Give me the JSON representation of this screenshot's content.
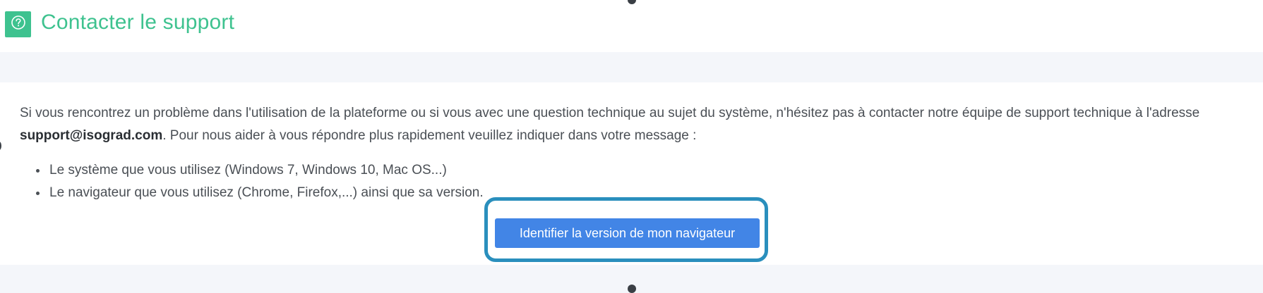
{
  "header": {
    "title": "Contacter le support",
    "icon": "question-circle-icon",
    "accent_color": "#3ec28f"
  },
  "support": {
    "intro_before_email": "Si vous rencontrez un problème dans l'utilisation de la plateforme ou si vous avec une question technique au sujet du système, n'hésitez pas à contacter notre équipe de support technique à l'adresse ",
    "email": "support@isograd.com",
    "intro_after_email": ". Pour nous aider à vous répondre plus rapidement veuillez indiquer dans votre message :",
    "items": [
      "Le système que vous utilisez (Windows 7, Windows 10, Mac OS...)",
      "Le navigateur que vous utilisez (Chrome, Firefox,...) ainsi que sa version."
    ],
    "button_label": "Identifier la version de mon navigateur",
    "button_color": "#4285e6",
    "highlight_color": "#2a8fbd"
  }
}
